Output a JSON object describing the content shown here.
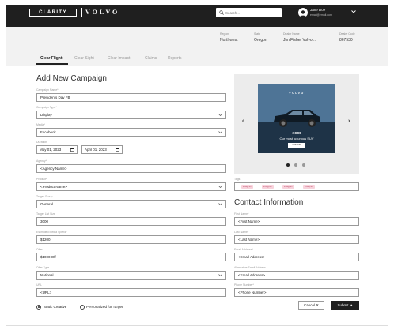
{
  "header": {
    "logo_text": "CLARITY",
    "brand_text": "VOLVO",
    "search_placeholder": "Search...",
    "user_name": "Jane Doe",
    "user_email": "email@email.com"
  },
  "meta": [
    {
      "label": "Region",
      "value": "Northwest"
    },
    {
      "label": "State",
      "value": "Oregon"
    },
    {
      "label": "Dealer Name",
      "value": "Jim Fisher Volvo..."
    },
    {
      "label": "Dealer Code",
      "value": "867530"
    }
  ],
  "tabs": [
    "Clear Flight",
    "Clear Sight",
    "Clear Impact",
    "Claims",
    "Reports"
  ],
  "page_title": "Add New Campaign",
  "form": {
    "campaign_name": {
      "label": "Campaign Name*",
      "value": "Presidents Day FB"
    },
    "campaign_type": {
      "label": "Campaign Type*",
      "value": "Display"
    },
    "media": {
      "label": "Media*",
      "value": "Facebook"
    },
    "duration": {
      "label": "Duration",
      "start": "May 01, 2023",
      "end": "April 01, 2023"
    },
    "agency": {
      "label": "Agency*",
      "value": "<Agency Name>"
    },
    "product": {
      "label": "Product*",
      "value": "<Product Name>"
    },
    "target_group": {
      "label": "Target Group",
      "value": "General"
    },
    "target_list_size": {
      "label": "Target List Size",
      "value": "3000"
    },
    "media_spend": {
      "label": "Estimated Media Spend*",
      "value": "$1200"
    },
    "offer": {
      "label": "Offer",
      "value": "$1000 Off"
    },
    "offer_type": {
      "label": "Offer Type",
      "value": "National"
    },
    "url": {
      "label": "URL",
      "value": "<URL>"
    },
    "tags": {
      "label": "Tags",
      "items": [
        "#Tag 1×",
        "#Tag 2×",
        "#Tag 3×",
        "#Tag 4×"
      ]
    }
  },
  "creative_options": {
    "static": "Static Creative",
    "personalized": "Personalized for Target",
    "selected": "static"
  },
  "carousel": {
    "ad_brand": "VOLVO",
    "ad_model": "XC90",
    "ad_tagline": "Our most luxurious SUV",
    "ad_button": "View Offer",
    "prev": "‹",
    "next": "›",
    "slide_count": 3,
    "active_slide": 1
  },
  "contact": {
    "title": "Contact Information",
    "first_name": {
      "label": "First Name*",
      "value": "<First Name>"
    },
    "last_name": {
      "label": "Last Name*",
      "value": "<Last Name>"
    },
    "email": {
      "label": "Email Address*",
      "value": "<Email Address>"
    },
    "alt_email": {
      "label": "Alternative Email Address",
      "value": "<Email Address>"
    },
    "phone": {
      "label": "Phone Number*",
      "value": "<Phone Number>"
    }
  },
  "actions": {
    "cancel": "Cancel ✕",
    "submit": "Submit ➜"
  }
}
